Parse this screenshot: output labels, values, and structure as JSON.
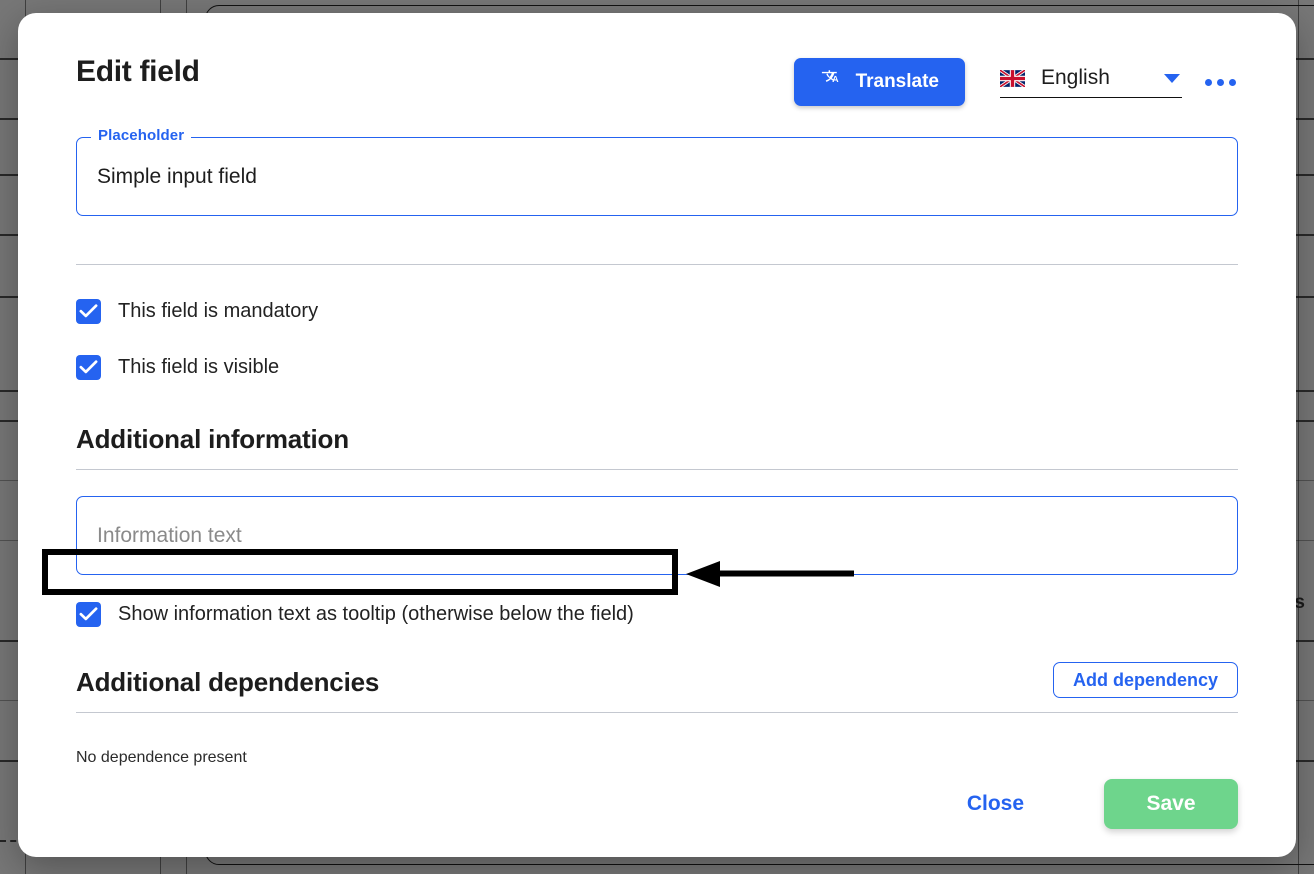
{
  "dialog": {
    "title": "Edit field",
    "header": {
      "translate_label": "Translate",
      "translate_icon": "translate-icon",
      "language_value": "English",
      "language_flag": "uk-flag-icon",
      "dropdown_icon": "chevron-down-icon",
      "overflow_icon": "more-options-icon",
      "accent_color": "#2563f0"
    },
    "placeholder_field": {
      "legend": "Placeholder",
      "value": "Simple input field"
    },
    "options": [
      {
        "label": "This field is mandatory",
        "checked": true
      },
      {
        "label": "This field is visible",
        "checked": true
      }
    ],
    "additional_information": {
      "heading": "Additional information",
      "info_input_placeholder": "Information text",
      "info_input_value": "",
      "tooltip_option": {
        "label": "Show information text as tooltip (otherwise below the field)",
        "checked": true
      }
    },
    "additional_dependencies": {
      "heading": "Additional dependencies",
      "add_button": "Add dependency",
      "empty_text": "No dependence present"
    },
    "footer": {
      "close_label": "Close",
      "save_label": "Save",
      "save_color": "#6ed58c"
    }
  },
  "background": {
    "edge_text": "ns"
  },
  "annotation": {
    "highlight_target": "tooltip-checkbox-row",
    "arrow_direction": "left",
    "color": "#000000"
  }
}
